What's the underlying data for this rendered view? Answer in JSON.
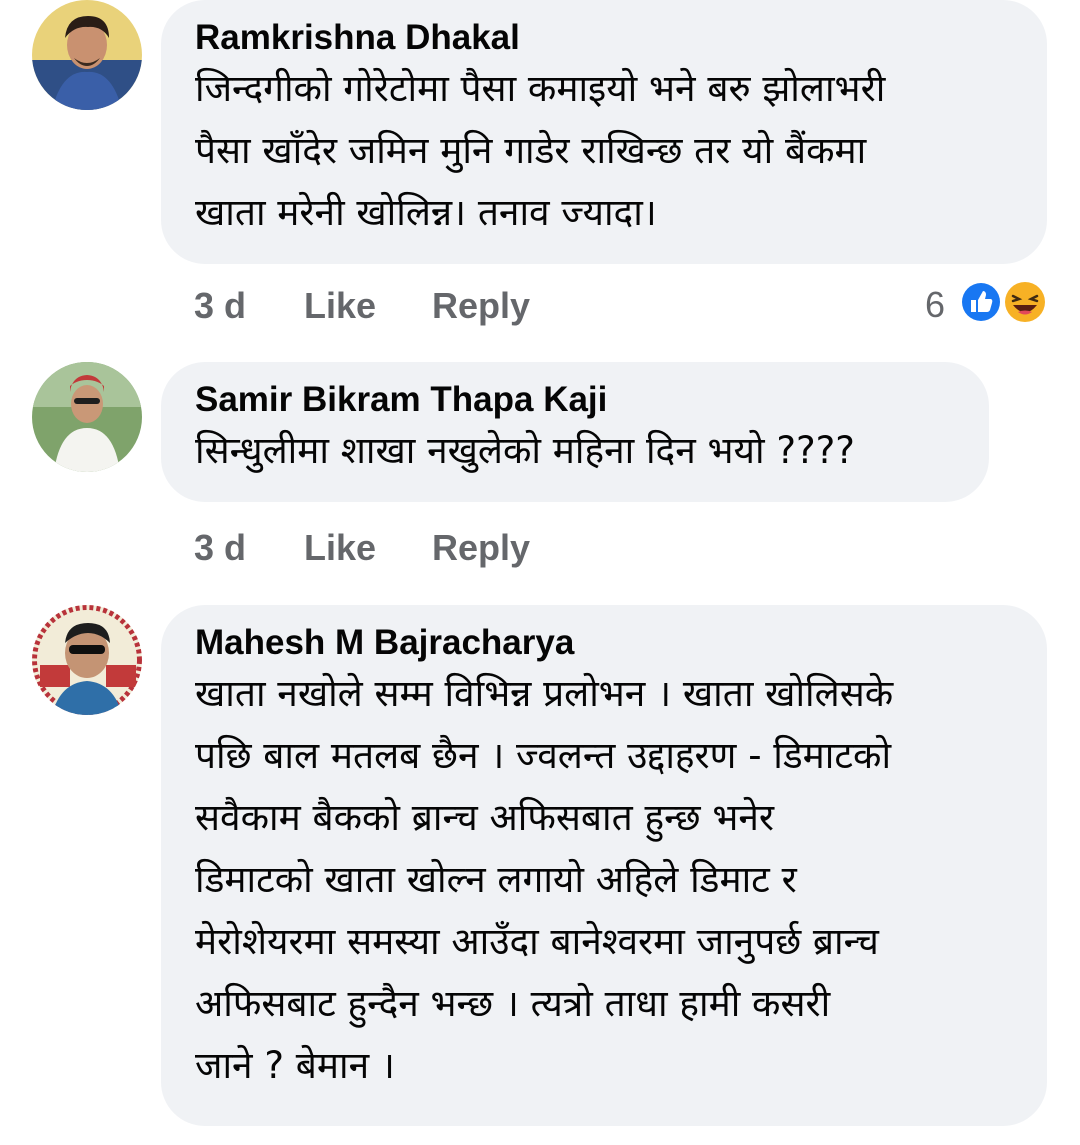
{
  "comments": [
    {
      "author": "Ramkrishna Dhakal",
      "text_lines": [
        "जिन्दगीको गोरेटोमा पैसा कमाइयो  भने बरु  झोलाभरी",
        "पैसा खाँदेर जमिन मुनि गाडेर  राखिन्छ तर यो बैंकमा",
        "खाता मरेनी खोलिन्न। तनाव ज्यादा।"
      ],
      "time": "3 d",
      "like_label": "Like",
      "reply_label": "Reply",
      "reactions": {
        "count": "6",
        "icons": [
          "like-icon",
          "haha-icon"
        ]
      }
    },
    {
      "author": "Samir Bikram Thapa Kaji",
      "text_lines": [
        "सिन्धुलीमा शाखा नखुलेको महिना दिन भयो ????"
      ],
      "time": "3 d",
      "like_label": "Like",
      "reply_label": "Reply"
    },
    {
      "author": "Mahesh M Bajracharya",
      "text_lines": [
        "खाता नखोले सम्म विभिन्न प्रलोभन । खाता खोलिसके",
        "पछि बाल मतलब छैन । ज्वलन्त उद्दाहरण - डिमाटको",
        "सवैकाम बैकको ब्रान्च अफिसबात हुन्छ भनेर",
        "डिमाटको खाता खोल्न लगायो अहिले डिमाट र",
        "मेरोशेयरमा समस्या आउँदा बानेश्वरमा जानुपर्छ ब्रान्च",
        "अफिसबाट हुन्दैन भन्छ । त्यत्रो ताधा हामी कसरी",
        "जाने ? बेमान ।"
      ]
    }
  ],
  "colors": {
    "bubble": "#f0f2f5",
    "secondary_text": "#65676b",
    "like_blue": "#1877f2",
    "haha_yellow": "#f7b125"
  }
}
